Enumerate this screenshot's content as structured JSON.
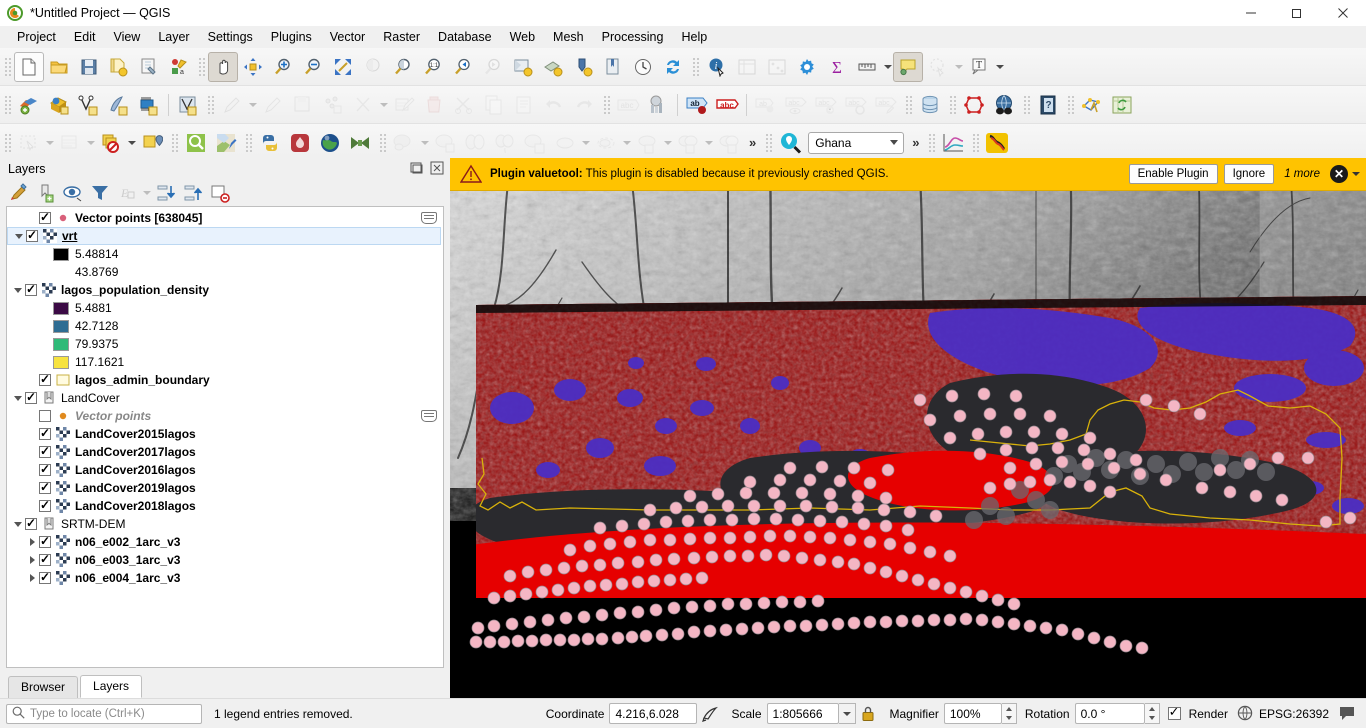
{
  "window": {
    "title": "*Untitled Project — QGIS",
    "minimize": "—",
    "maximize": "❐",
    "close": "✕"
  },
  "menubar": {
    "items": [
      {
        "label": "Project"
      },
      {
        "label": "Edit"
      },
      {
        "label": "View"
      },
      {
        "label": "Layer"
      },
      {
        "label": "Settings"
      },
      {
        "label": "Plugins"
      },
      {
        "label": "Vector"
      },
      {
        "label": "Raster"
      },
      {
        "label": "Database"
      },
      {
        "label": "Web"
      },
      {
        "label": "Mesh"
      },
      {
        "label": "Processing"
      },
      {
        "label": "Help"
      }
    ]
  },
  "toolbar": {
    "project_selector_value": "Ghana",
    "overflow_chevron": "»"
  },
  "message_bar": {
    "icon": "warning-icon",
    "title": "Plugin valuetool:",
    "text": "This plugin is disabled because it previously crashed QGIS.",
    "enable_label": "Enable Plugin",
    "ignore_label": "Ignore",
    "more_label": "1 more",
    "close_label": "✕"
  },
  "layers_panel": {
    "title": "Layers",
    "tabs": [
      {
        "label": "Browser",
        "active": false
      },
      {
        "label": "Layers",
        "active": true
      }
    ],
    "tree": [
      {
        "type": "layer",
        "label": "Vector points [638045]",
        "checked": true,
        "expander": "none",
        "icon": "point-layer-icon",
        "indent": 1,
        "style": "bold",
        "edit_badge": true
      },
      {
        "type": "layer",
        "label": "vrt",
        "checked": true,
        "expander": "open",
        "icon": "raster-layer-icon",
        "indent": 0,
        "style": "underline",
        "selected": true
      },
      {
        "type": "legend",
        "label": "5.48814",
        "swatch": "#000000",
        "indent": 3
      },
      {
        "type": "legend",
        "label": "43.8769",
        "swatch": "",
        "indent": 3
      },
      {
        "type": "layer",
        "label": "lagos_population_density",
        "checked": true,
        "expander": "open",
        "icon": "raster-layer-icon",
        "indent": 0,
        "style": "bold"
      },
      {
        "type": "legend",
        "label": "5.4881",
        "swatch": "#3b0a45",
        "indent": 3
      },
      {
        "type": "legend",
        "label": "42.7128",
        "swatch": "#2f6d93",
        "indent": 3
      },
      {
        "type": "legend",
        "label": "79.9375",
        "swatch": "#2fba78",
        "indent": 3
      },
      {
        "type": "legend",
        "label": "117.1621",
        "swatch": "#f7e340",
        "indent": 3
      },
      {
        "type": "layer",
        "label": "lagos_admin_boundary",
        "checked": true,
        "expander": "none",
        "icon": "polygon-layer-icon",
        "indent": 1,
        "style": "bold"
      },
      {
        "type": "group",
        "label": "LandCover",
        "checked": true,
        "expander": "open",
        "icon": "group-icon",
        "indent": 0,
        "style": "normal"
      },
      {
        "type": "layer",
        "label": "Vector points",
        "checked": false,
        "expander": "none",
        "icon": "point-layer-icon-orange",
        "indent": 2,
        "style": "italic-grey",
        "edit_badge": true
      },
      {
        "type": "layer",
        "label": "LandCover2015lagos",
        "checked": true,
        "expander": "none",
        "icon": "raster-layer-icon",
        "indent": 2,
        "style": "bold"
      },
      {
        "type": "layer",
        "label": "LandCover2017lagos",
        "checked": true,
        "expander": "none",
        "icon": "raster-layer-icon",
        "indent": 2,
        "style": "bold"
      },
      {
        "type": "layer",
        "label": "LandCover2016lagos",
        "checked": true,
        "expander": "none",
        "icon": "raster-layer-icon",
        "indent": 2,
        "style": "bold"
      },
      {
        "type": "layer",
        "label": "LandCover2019lagos",
        "checked": true,
        "expander": "none",
        "icon": "raster-layer-icon",
        "indent": 2,
        "style": "bold"
      },
      {
        "type": "layer",
        "label": "LandCover2018lagos",
        "checked": true,
        "expander": "none",
        "icon": "raster-layer-icon",
        "indent": 2,
        "style": "bold"
      },
      {
        "type": "group",
        "label": "SRTM-DEM",
        "checked": true,
        "expander": "open",
        "icon": "group-icon",
        "indent": 0,
        "style": "normal"
      },
      {
        "type": "layer",
        "label": "n06_e002_1arc_v3",
        "checked": true,
        "expander": "closed",
        "icon": "raster-layer-icon",
        "indent": 2,
        "style": "bold"
      },
      {
        "type": "layer",
        "label": "n06_e003_1arc_v3",
        "checked": true,
        "expander": "closed",
        "icon": "raster-layer-icon",
        "indent": 2,
        "style": "bold"
      },
      {
        "type": "layer",
        "label": "n06_e004_1arc_v3",
        "checked": true,
        "expander": "closed",
        "icon": "raster-layer-icon",
        "indent": 2,
        "style": "bold"
      }
    ]
  },
  "status_bar": {
    "locator_placeholder": "Type to locate (Ctrl+K)",
    "message": "1 legend entries removed.",
    "coordinate_label": "Coordinate",
    "coordinate_value": "4.216,6.028",
    "scale_label": "Scale",
    "scale_value": "1:805666",
    "magnifier_label": "Magnifier",
    "magnifier_value": "100%",
    "rotation_label": "Rotation",
    "rotation_value": "0.0 °",
    "render_label": "Render",
    "crs_label": "EPSG:26392"
  },
  "colors": {
    "message_bar_bg": "#ffc300",
    "selection_blue": "#e8f2fd",
    "map_red": "#e60000",
    "map_dark_red": "#8f0b0b",
    "map_purple": "#4b2ec4",
    "map_point": "#f4b6c4",
    "boundary_yellow": "#d9b20a"
  }
}
